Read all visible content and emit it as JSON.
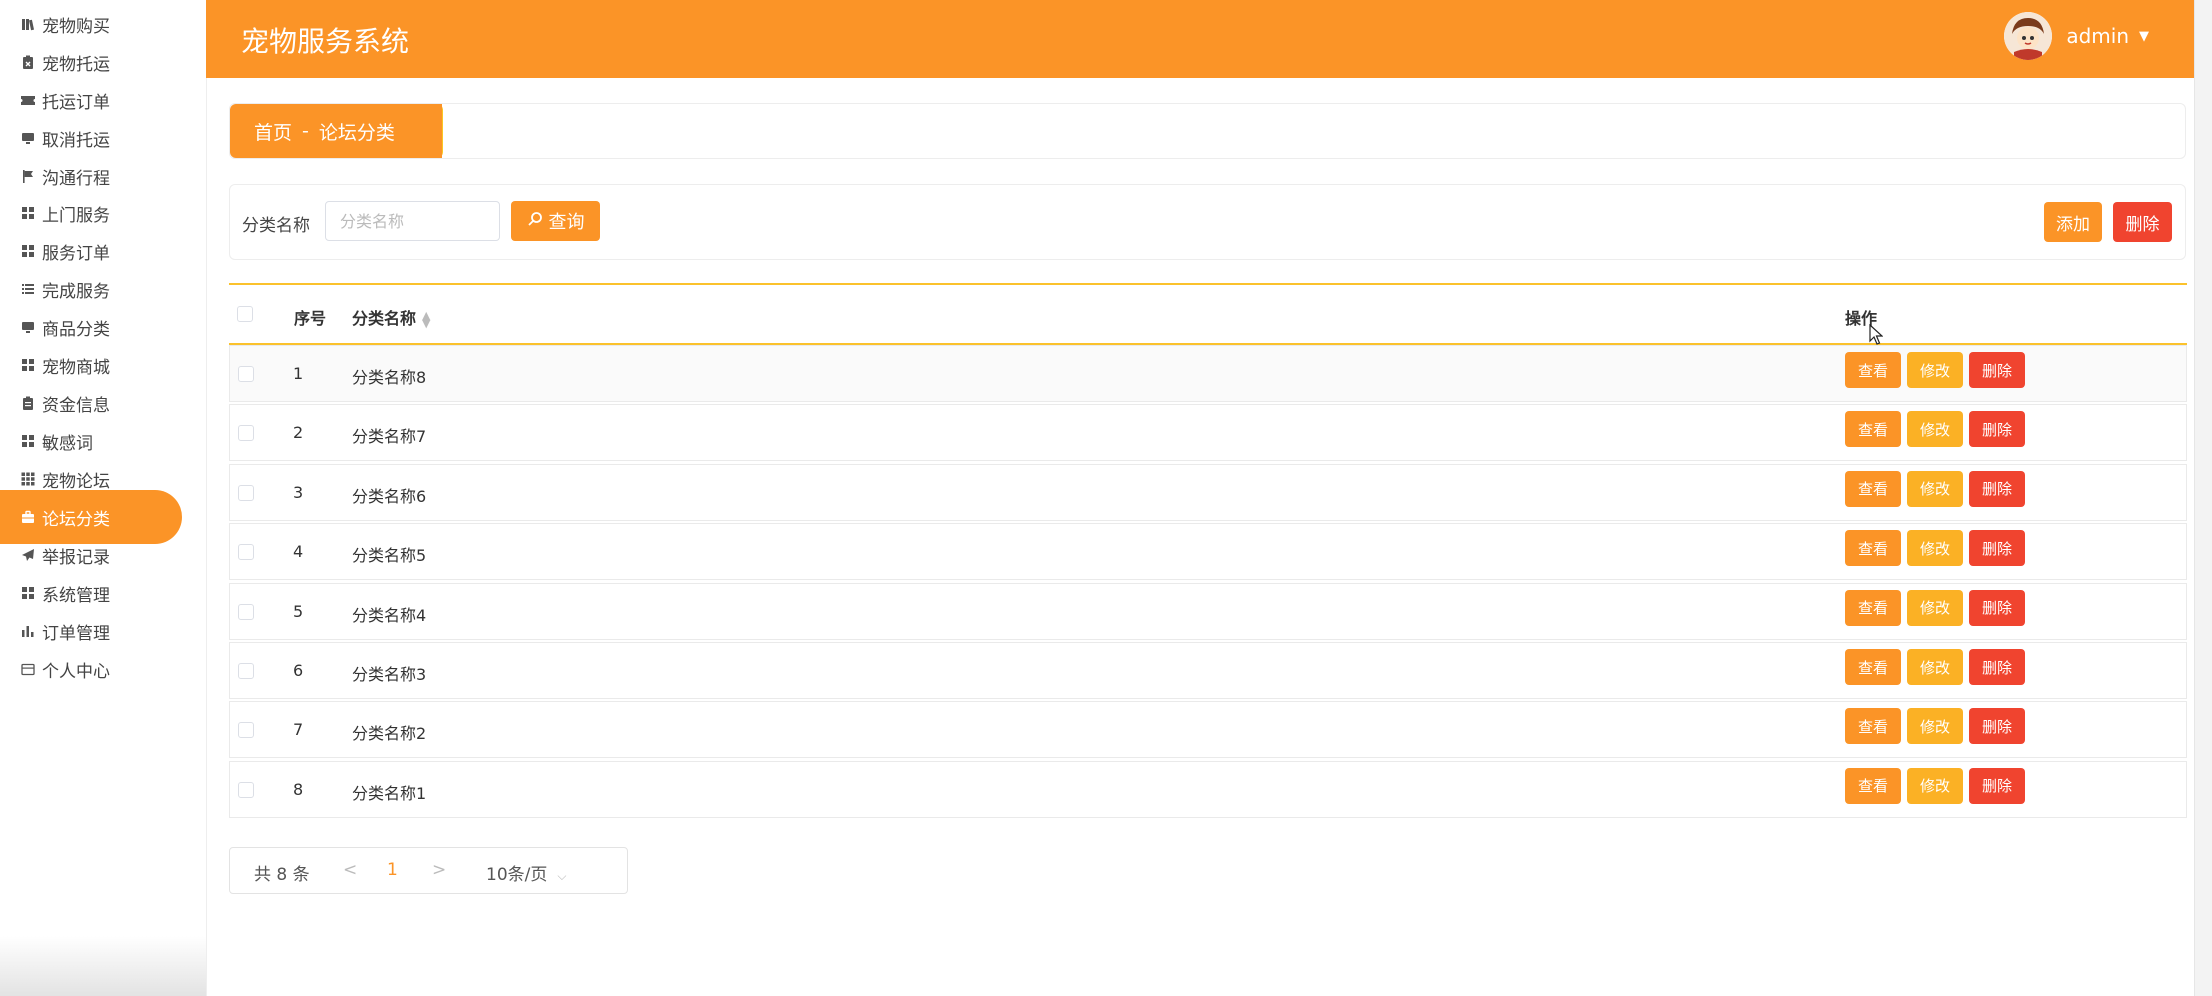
{
  "app": {
    "title": "宠物服务系统",
    "user": "admin"
  },
  "colors": {
    "accent": "#fb9427",
    "danger": "#f0442f",
    "edit": "#fbb125"
  },
  "sidebar": {
    "items": [
      {
        "label": "宠物购买",
        "icon": "books-icon"
      },
      {
        "label": "宠物托运",
        "icon": "clipboard-x-icon"
      },
      {
        "label": "托运订单",
        "icon": "ticket-icon"
      },
      {
        "label": "取消托运",
        "icon": "monitor-icon"
      },
      {
        "label": "沟通行程",
        "icon": "flag-icon"
      },
      {
        "label": "上门服务",
        "icon": "grid-icon"
      },
      {
        "label": "服务订单",
        "icon": "grid-icon"
      },
      {
        "label": "完成服务",
        "icon": "list-icon"
      },
      {
        "label": "商品分类",
        "icon": "monitor-icon"
      },
      {
        "label": "宠物商城",
        "icon": "grid-icon"
      },
      {
        "label": "资金信息",
        "icon": "clipboard-icon"
      },
      {
        "label": "敏感词",
        "icon": "grid-icon"
      },
      {
        "label": "宠物论坛",
        "icon": "apps-icon"
      },
      {
        "label": "论坛分类",
        "icon": "briefcase-icon",
        "active": true
      },
      {
        "label": "举报记录",
        "icon": "send-icon"
      },
      {
        "label": "系统管理",
        "icon": "grid-icon"
      },
      {
        "label": "订单管理",
        "icon": "bar-chart-icon"
      },
      {
        "label": "个人中心",
        "icon": "wallet-icon"
      }
    ]
  },
  "breadcrumb": {
    "home": "首页",
    "separator": "-",
    "current": "论坛分类"
  },
  "search": {
    "label": "分类名称",
    "placeholder": "分类名称",
    "query_button": "查询",
    "add_button": "添加",
    "delete_button": "删除"
  },
  "table": {
    "headers": {
      "index": "序号",
      "name": "分类名称",
      "actions": "操作"
    },
    "rows": [
      {
        "index": "1",
        "name": "分类名称8"
      },
      {
        "index": "2",
        "name": "分类名称7"
      },
      {
        "index": "3",
        "name": "分类名称6"
      },
      {
        "index": "4",
        "name": "分类名称5"
      },
      {
        "index": "5",
        "name": "分类名称4"
      },
      {
        "index": "6",
        "name": "分类名称3"
      },
      {
        "index": "7",
        "name": "分类名称2"
      },
      {
        "index": "8",
        "name": "分类名称1"
      }
    ],
    "row_actions": {
      "view": "查看",
      "edit": "修改",
      "delete": "删除"
    }
  },
  "pagination": {
    "total": "共 8 条",
    "prev": "<",
    "current_page": "1",
    "next": ">",
    "page_size": "10条/页"
  }
}
